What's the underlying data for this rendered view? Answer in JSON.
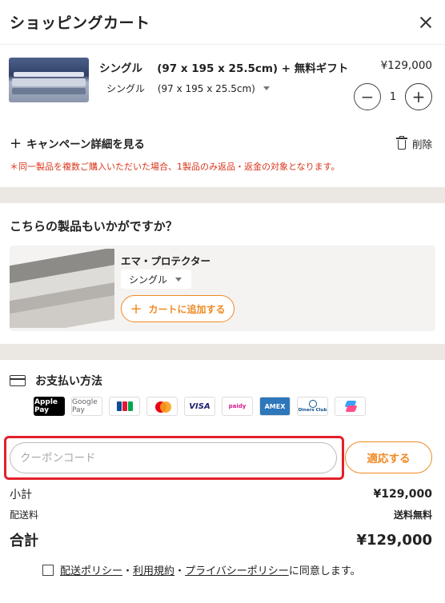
{
  "header": {
    "title": "ショッピングカート"
  },
  "cart": {
    "item": {
      "name": "シングル　 (97 x 195 x 25.5cm) + 無料ギフト",
      "price": "¥129,000",
      "variant": "シングル　 (97 x 195 x 25.5cm)",
      "quantity": "1"
    },
    "campaign_link": "キャンペーン詳細を見る",
    "delete_label": "削除",
    "notice": "＊同一製品を複数ご購入いただいた場合、1製品のみ返品・返金の対象となります。"
  },
  "recommend": {
    "title": "こちらの製品もいかがですか？",
    "product_name": "エマ・プロテクター",
    "size_value": "シングル",
    "add_label": "カートに追加する"
  },
  "payment": {
    "title": "お支払い方法",
    "logos": [
      "Apple Pay",
      "Google Pay",
      "JCB",
      "Mastercard",
      "VISA",
      "paidy",
      "AMEX",
      "Diners Club",
      "Shop"
    ]
  },
  "coupon": {
    "placeholder": "クーポンコード",
    "apply_label": "適応する"
  },
  "totals": {
    "subtotal_label": "小計",
    "subtotal_value": "¥129,000",
    "shipping_label": "配送料",
    "shipping_value": "送料無料",
    "total_label": "合計",
    "total_value": "¥129,000"
  },
  "agreement": {
    "shipping_policy": "配送ポリシー",
    "sep1": "・",
    "terms": "利用規約",
    "sep2": "・",
    "privacy": "プライバシーポリシー",
    "suffix": "に同意します。"
  },
  "colors": {
    "accent": "#f08a24",
    "alert": "#d9361b",
    "highlight": "#e3202b",
    "band": "#ebe7e3"
  }
}
